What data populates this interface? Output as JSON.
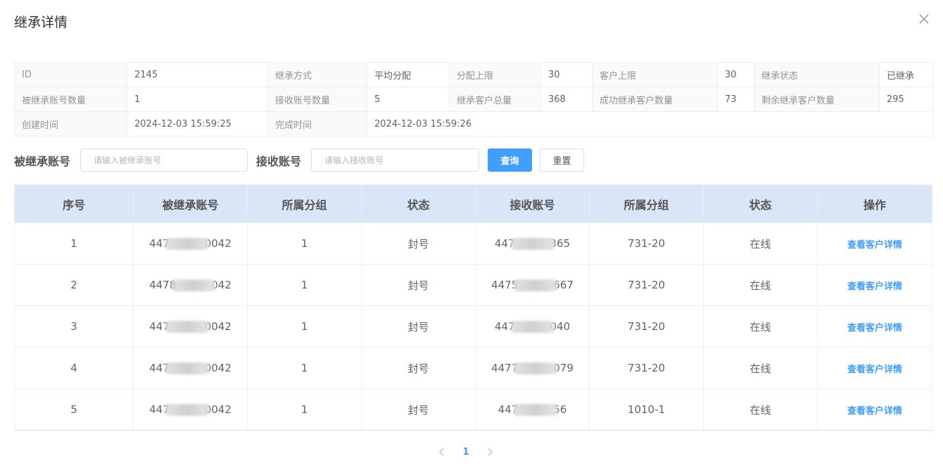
{
  "dialog": {
    "title": "继承详情"
  },
  "info": {
    "row1": [
      {
        "label": "ID",
        "value": "2145"
      },
      {
        "label": "继承方式",
        "value": "平均分配"
      },
      {
        "label": "分配上限",
        "value": "30"
      },
      {
        "label": "客户上限",
        "value": "30"
      },
      {
        "label": "继承状态",
        "value": "已继承"
      }
    ],
    "row2": [
      {
        "label": "被继承账号数量",
        "value": "1"
      },
      {
        "label": "接收账号数量",
        "value": "5"
      },
      {
        "label": "继承客户总量",
        "value": "368"
      },
      {
        "label": "成功继承客户数量",
        "value": "73"
      },
      {
        "label": "剩余继承客户数量",
        "value": "295"
      }
    ],
    "row3": [
      {
        "label": "创建时间",
        "value": "2024-12-03 15:59:25"
      },
      {
        "label": "完成时间",
        "value": "2024-12-03 15:59:26"
      }
    ]
  },
  "search": {
    "source_label": "被继承账号",
    "source_placeholder": "请输入被继承账号",
    "target_label": "接收账号",
    "target_placeholder": "请输入接收账号",
    "query_button": "查询",
    "reset_button": "重置"
  },
  "table": {
    "headers": [
      "序号",
      "被继承账号",
      "所属分组",
      "状态",
      "接收账号",
      "所属分组",
      "状态",
      "操作"
    ],
    "rows": [
      {
        "index": "1",
        "src_pre": "447",
        "src_suf": "0042",
        "src_group": "1",
        "src_status": "封号",
        "dst_pre": "447",
        "dst_suf": "365",
        "dst_group": "731-20",
        "dst_status": "在线",
        "action": "查看客户详情"
      },
      {
        "index": "2",
        "src_pre": "4478",
        "src_suf": "042",
        "src_group": "1",
        "src_status": "封号",
        "dst_pre": "4475",
        "dst_suf": "667",
        "dst_group": "731-20",
        "dst_status": "在线",
        "action": "查看客户详情"
      },
      {
        "index": "3",
        "src_pre": "447",
        "src_suf": "0042",
        "src_group": "1",
        "src_status": "封号",
        "dst_pre": "447",
        "dst_suf": "040",
        "dst_group": "731-20",
        "dst_status": "在线",
        "action": "查看客户详情"
      },
      {
        "index": "4",
        "src_pre": "447",
        "src_suf": "0042",
        "src_group": "1",
        "src_status": "封号",
        "dst_pre": "4477",
        "dst_suf": "079",
        "dst_group": "731-20",
        "dst_status": "在线",
        "action": "查看客户详情"
      },
      {
        "index": "5",
        "src_pre": "447",
        "src_suf": "0042",
        "src_group": "1",
        "src_status": "封号",
        "dst_pre": "447",
        "dst_suf": "56",
        "dst_group": "1010-1",
        "dst_status": "在线",
        "action": "查看客户详情"
      }
    ]
  },
  "pagination": {
    "current_page": "1",
    "prev_icon": "chevron-left-icon",
    "next_icon": "chevron-right-icon"
  },
  "colors": {
    "accent": "#409eff",
    "header_bg": "#d9e6f8",
    "border": "#ebeef5"
  }
}
